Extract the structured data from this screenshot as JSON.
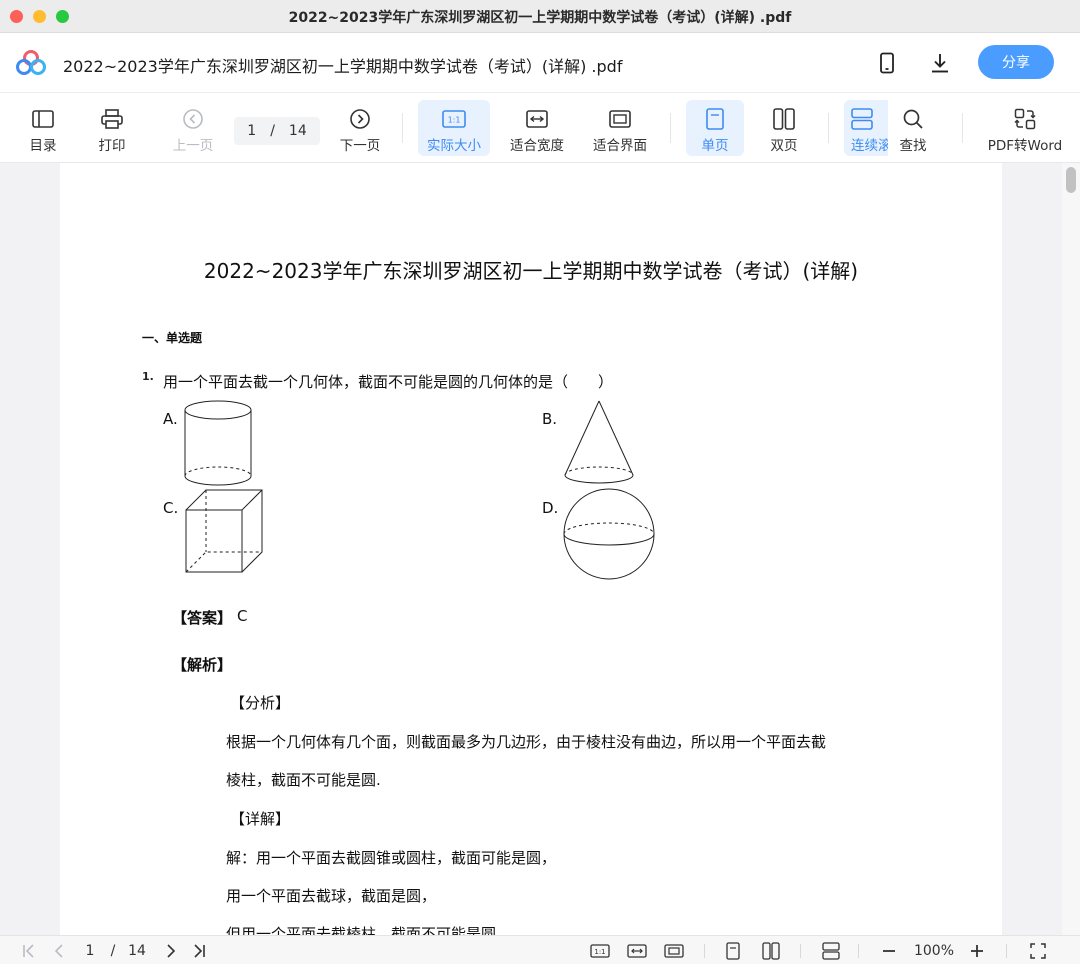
{
  "window": {
    "title": "2022~2023学年广东深圳罗湖区初一上学期期中数学试卷（考试）(详解) .pdf"
  },
  "header": {
    "doc_title": "2022~2023学年广东深圳罗湖区初一上学期期中数学试卷（考试）(详解) .pdf",
    "share_label": "分享",
    "icons": [
      "app-logo",
      "phone-icon",
      "download-icon"
    ]
  },
  "toolbar": {
    "toc": "目录",
    "print": "打印",
    "prev": "上一页",
    "page_current": "1",
    "page_sep": "/",
    "page_total": "14",
    "next": "下一页",
    "actual_size": "实际大小",
    "fit_width": "适合宽度",
    "fit_page": "适合界面",
    "single": "单页",
    "double": "双页",
    "continuous": "连续滚",
    "find": "查找",
    "pdf2word": "PDF转Word",
    "actual_size_icon_text": "1:1",
    "accent": "#3d8bf2"
  },
  "document": {
    "title": "2022~2023学年广东深圳罗湖区初一上学期期中数学试卷（考试）(详解)",
    "section": "一、单选题",
    "question_number": "1.",
    "question_text": "用一个平面去截一个几何体，截面不可能是圆的几何体的是（　　）",
    "options": {
      "a": "A.",
      "b": "B.",
      "c": "C.",
      "d": "D."
    },
    "answer_label": "【答案】",
    "answer_value": "C",
    "analysis_label": "【解析】",
    "fenxi_label": "【分析】",
    "fenxi_line1": "根据一个几何体有几个面，则截面最多为几边形，由于棱柱没有曲边，所以用一个平面去截",
    "fenxi_line2": "棱柱，截面不可能是圆.",
    "detail_label": "【详解】",
    "detail_line1": "解：用一个平面去截圆锥或圆柱，截面可能是圆，",
    "detail_line2": "用一个平面去截球，截面是圆，",
    "detail_line3": "但用一个平面去截棱柱，截面不可能是圆."
  },
  "bottombar": {
    "page_current": "1",
    "page_sep": "/",
    "page_total": "14",
    "zoom": "100%",
    "icon_1to1": "1:1"
  }
}
